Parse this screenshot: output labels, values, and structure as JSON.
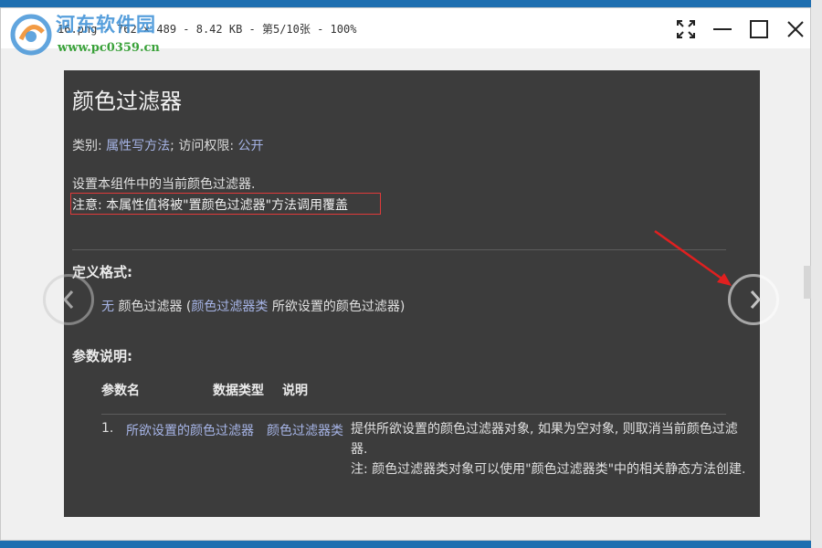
{
  "window": {
    "title": "16.png - 762 × 489 - 8.42 KB - 第5/10张 - 100%"
  },
  "watermark": {
    "name": "河东软件园",
    "url": "www.pc0359.cn"
  },
  "document": {
    "title": "颜色过滤器",
    "meta": {
      "category_label": "类别:",
      "category_value": "属性写方法",
      "separator": ";",
      "access_label": "访问权限:",
      "access_value": "公开"
    },
    "description": "设置本组件中的当前颜色过滤器.",
    "note": "注意: 本属性值将被\"置颜色过滤器\"方法调用覆盖",
    "format_heading": "定义格式:",
    "format": {
      "return_type": "无",
      "name": "颜色过滤器 (",
      "param_type": "颜色过滤器类",
      "param_desc": "所欲设置的颜色过滤器)"
    },
    "params_heading": "参数说明:",
    "table": {
      "headers": [
        "参数名",
        "数据类型",
        "说明"
      ],
      "rows": [
        {
          "index": "1.",
          "name": "所欲设置的颜色过滤器",
          "type": "颜色过滤器类",
          "desc_line1": "提供所欲设置的颜色过滤器对象, 如果为空对象, 则取消当前颜色过滤器.",
          "desc_line2": "注: 颜色过滤器类对象可以使用\"颜色过滤器类\"中的相关静态方法创建."
        }
      ]
    }
  },
  "icons": {
    "fullscreen": "fullscreen-icon",
    "minimize": "minimize-icon",
    "maximize": "maximize-icon",
    "close": "close-icon",
    "prev": "chevron-left-icon",
    "next": "chevron-right-icon"
  },
  "colors": {
    "viewer_bg": "#3c3c3c",
    "link": "#a6b4e6",
    "highlight_box": "#e03a3a",
    "arrow": "#e02020"
  }
}
